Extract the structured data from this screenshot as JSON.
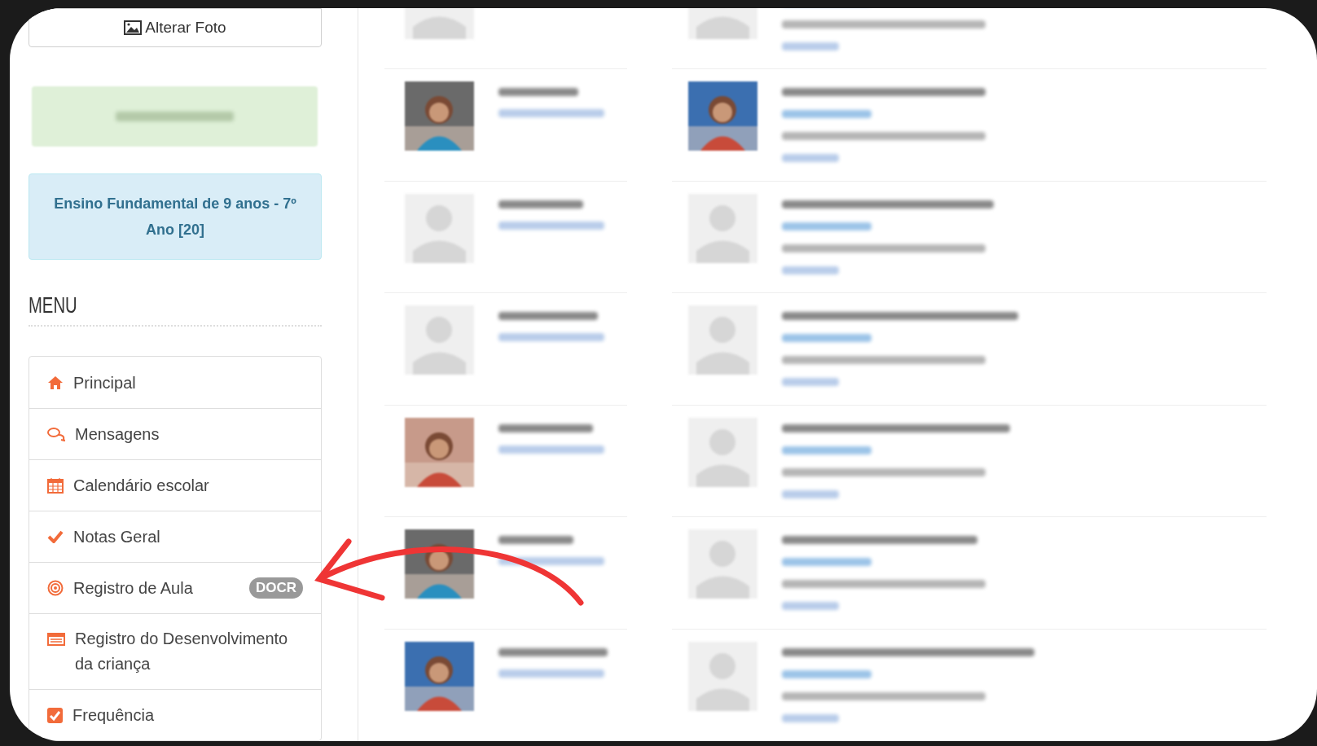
{
  "sidebar": {
    "photo_button": "Alterar Foto",
    "level_box": "Ensino Fundamental de 9 anos - 7º Ano [20]",
    "menu_title": "MENU",
    "menu": [
      {
        "kind": "home",
        "label": "Principal"
      },
      {
        "kind": "chat",
        "label": "Mensagens"
      },
      {
        "kind": "calendar",
        "label": "Calendário escolar"
      },
      {
        "kind": "check",
        "label": "Notas Geral"
      },
      {
        "kind": "target",
        "label": "Registro de Aula",
        "badge": "DOCR"
      },
      {
        "kind": "list",
        "label": "Registro do Desenvolvimento da criança"
      },
      {
        "kind": "checkbox",
        "label": "Frequência"
      }
    ]
  },
  "teachers": [
    {
      "has_photo": false
    },
    {
      "has_photo": true
    },
    {
      "has_photo": false
    },
    {
      "has_photo": false
    },
    {
      "has_photo": true
    },
    {
      "has_photo": true
    },
    {
      "has_photo": true
    }
  ],
  "students": [
    {
      "has_photo": false
    },
    {
      "has_photo": true
    },
    {
      "has_photo": false
    },
    {
      "has_photo": false
    },
    {
      "has_photo": false
    },
    {
      "has_photo": false
    },
    {
      "has_photo": false
    }
  ],
  "annotation": {
    "kind": "arrow"
  }
}
